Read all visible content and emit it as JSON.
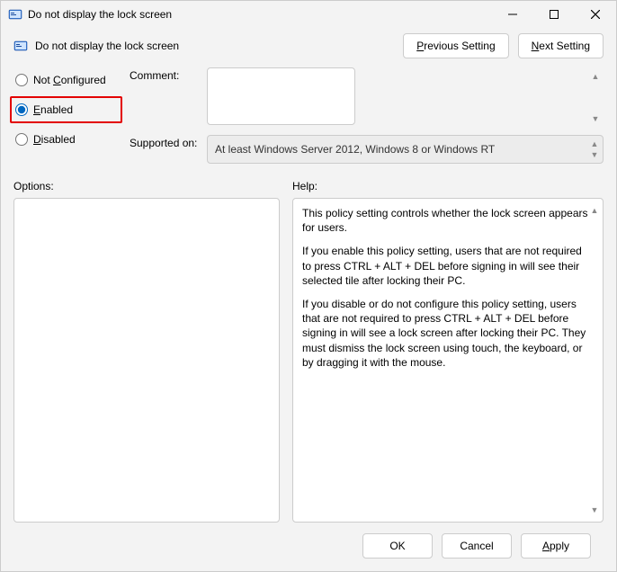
{
  "window": {
    "title": "Do not display the lock screen"
  },
  "header": {
    "title": "Do not display the lock screen",
    "prev_button": "Previous Setting",
    "next_button": "Next Setting"
  },
  "radios": {
    "not_configured": "Not Configured",
    "enabled": "Enabled",
    "disabled": "Disabled",
    "selected": "enabled"
  },
  "comment": {
    "label": "Comment:",
    "value": ""
  },
  "supported": {
    "label": "Supported on:",
    "value": "At least Windows Server 2012, Windows 8 or Windows RT"
  },
  "options": {
    "label": "Options:"
  },
  "help": {
    "label": "Help:",
    "p1": "This policy setting controls whether the lock screen appears for users.",
    "p2": "If you enable this policy setting, users that are not required to press CTRL + ALT + DEL before signing in will see their selected tile after locking their PC.",
    "p3": "If you disable or do not configure this policy setting, users that are not required to press CTRL + ALT + DEL before signing in will see a lock screen after locking their PC. They must dismiss the lock screen using touch, the keyboard, or by dragging it with the mouse."
  },
  "footer": {
    "ok": "OK",
    "cancel": "Cancel",
    "apply": "Apply"
  }
}
